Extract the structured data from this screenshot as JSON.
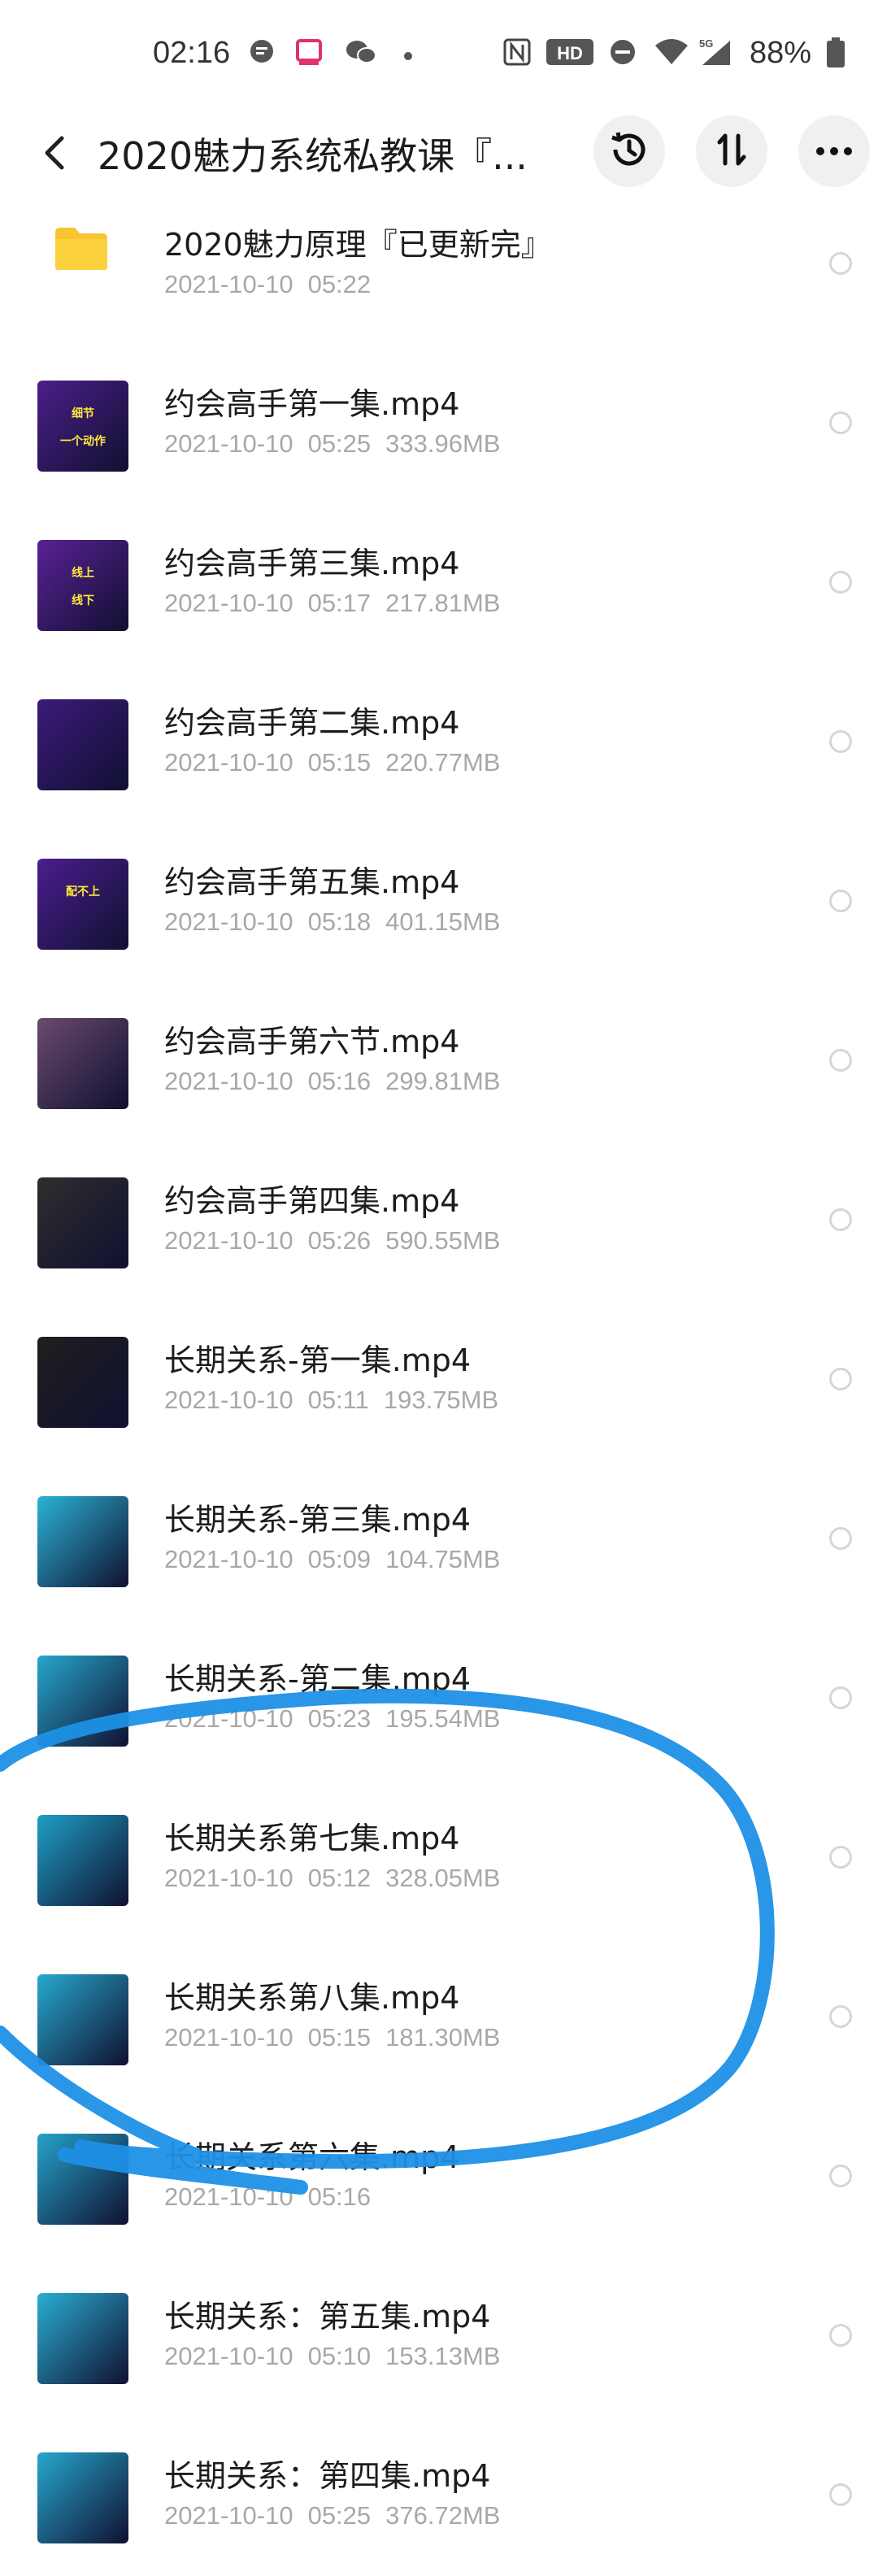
{
  "status_bar": {
    "time": "02:16",
    "battery": "88%",
    "network": "5G",
    "hd": "HD"
  },
  "header": {
    "title": "2020魅力系统私教课『...",
    "icons": [
      "back-arrow-icon",
      "history-clock-icon",
      "sort-icon",
      "more-dots-icon"
    ]
  },
  "files": [
    {
      "name": "2020魅力原理『已更新完』",
      "date": "2021-10-10",
      "time": "05:22",
      "size": "",
      "type": "folder"
    },
    {
      "name": "约会高手第一集.mp4",
      "date": "2021-10-10",
      "time": "05:25",
      "size": "333.96MB",
      "type": "video",
      "thumb_color": "#4b1f8a",
      "thumb_text": [
        "细节",
        "一个动作"
      ]
    },
    {
      "name": "约会高手第三集.mp4",
      "date": "2021-10-10",
      "time": "05:17",
      "size": "217.81MB",
      "type": "video",
      "thumb_color": "#5a2196",
      "thumb_text": [
        "线上",
        "线下"
      ]
    },
    {
      "name": "约会高手第二集.mp4",
      "date": "2021-10-10",
      "time": "05:15",
      "size": "220.77MB",
      "type": "video",
      "thumb_color": "#3d1a7a",
      "thumb_text": []
    },
    {
      "name": "约会高手第五集.mp4",
      "date": "2021-10-10",
      "time": "05:18",
      "size": "401.15MB",
      "type": "video",
      "thumb_color": "#4a1e8e",
      "thumb_text": [
        "配不上"
      ]
    },
    {
      "name": "约会高手第六节.mp4",
      "date": "2021-10-10",
      "time": "05:16",
      "size": "299.81MB",
      "type": "video",
      "thumb_color": "#6a4a6e",
      "thumb_text": []
    },
    {
      "name": "约会高手第四集.mp4",
      "date": "2021-10-10",
      "time": "05:26",
      "size": "590.55MB",
      "type": "video",
      "thumb_color": "#2e2e2e",
      "thumb_text": []
    },
    {
      "name": "长期关系-第一集.mp4",
      "date": "2021-10-10",
      "time": "05:11",
      "size": "193.75MB",
      "type": "video",
      "thumb_color": "#1f1f1f",
      "thumb_text": []
    },
    {
      "name": "长期关系-第三集.mp4",
      "date": "2021-10-10",
      "time": "05:09",
      "size": "104.75MB",
      "type": "video",
      "thumb_color": "#2bb3d6",
      "thumb_text": []
    },
    {
      "name": "长期关系-第二集.mp4",
      "date": "2021-10-10",
      "time": "05:23",
      "size": "195.54MB",
      "type": "video",
      "thumb_color": "#27a6cc",
      "thumb_text": []
    },
    {
      "name": "长期关系第七集.mp4",
      "date": "2021-10-10",
      "time": "05:12",
      "size": "328.05MB",
      "type": "video",
      "thumb_color": "#1f9fc6",
      "thumb_text": []
    },
    {
      "name": "长期关系第八集.mp4",
      "date": "2021-10-10",
      "time": "05:15",
      "size": "181.30MB",
      "type": "video",
      "thumb_color": "#27a9cf",
      "thumb_text": []
    },
    {
      "name": "长期关系第六集.mp4",
      "date": "2021-10-10",
      "time": "05:16",
      "size": "",
      "type": "video",
      "thumb_color": "#25a3cb",
      "thumb_text": []
    },
    {
      "name": "长期关系：第五集.mp4",
      "date": "2021-10-10",
      "time": "05:10",
      "size": "153.13MB",
      "type": "video",
      "thumb_color": "#2aaed3",
      "thumb_text": []
    },
    {
      "name": "长期关系：第四集.mp4",
      "date": "2021-10-10",
      "time": "05:25",
      "size": "376.72MB",
      "type": "video",
      "thumb_color": "#26a7cf",
      "thumb_text": []
    }
  ],
  "annotation_color": "#1e90e6"
}
